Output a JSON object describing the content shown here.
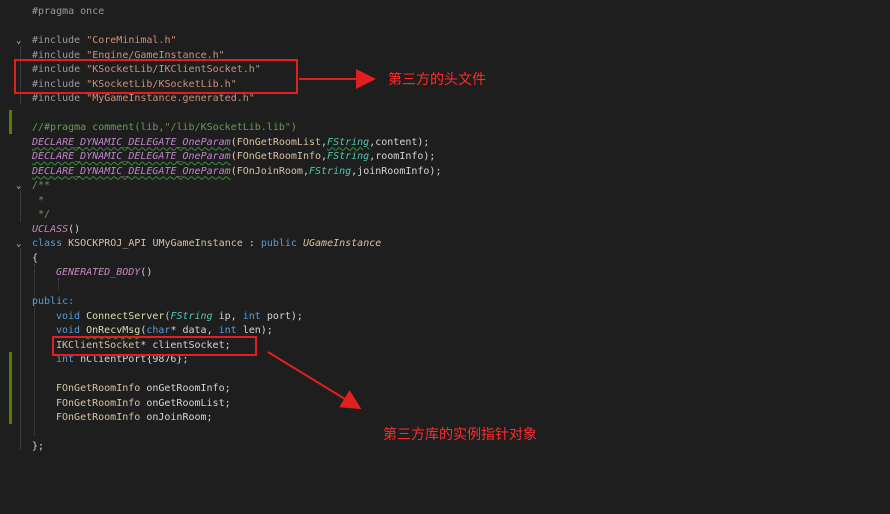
{
  "code": {
    "pragma": "#pragma once",
    "include_kw": "#include",
    "includes": [
      "\"CoreMinimal.h\"",
      "\"Engine/GameInstance.h\"",
      "\"KSocketLib/IKClientSocket.h\"",
      "\"KSocketLib/KSocketLib.h\"",
      "\"MyGameInstance.generated.h\""
    ],
    "comment_pragma": "//#pragma comment(lib,\"/lib/KSocketLib.lib\")",
    "delegate_macro": "DECLARE_DYNAMIC_DELEGATE_OneParam",
    "delegates": [
      {
        "name": "FOnGetRoomList",
        "type": "FString",
        "param": "content"
      },
      {
        "name": "FOnGetRoomInfo",
        "type": "FString",
        "param": "roomInfo"
      },
      {
        "name": "FOnJoinRoom",
        "type": "FString",
        "param": "joinRoomInfo"
      }
    ],
    "doc_open": "/**",
    "doc_mid": " *",
    "doc_close": " */",
    "uclass": "UCLASS",
    "class_kw": "class",
    "api": "KSOCKPROJ_API",
    "class_name": "UMyGameInstance",
    "public_kw": "public",
    "base_class": "UGameInstance",
    "open_brace": "{",
    "generated_body": "GENERATED_BODY",
    "public_label": "public:",
    "void_kw": "void",
    "int_kw": "int",
    "char_kw": "char",
    "connect_fn": "ConnectServer",
    "fstring": "FString",
    "ip": "ip",
    "port": "port",
    "recv_fn": "OnRecvMsg",
    "data": "data",
    "len": "len",
    "socket_type": "IKClientSocket",
    "socket_var": "clientSocket",
    "port_decl": "nClientPort{9876}",
    "members": [
      {
        "type": "FOnGetRoomInfo",
        "name": "onGetRoomInfo"
      },
      {
        "type": "FOnGetRoomInfo",
        "name": "onGetRoomList"
      },
      {
        "type": "FOnGetRoomInfo",
        "name": "onJoinRoom"
      }
    ],
    "close_brace": "};"
  },
  "annotations": {
    "headers": "第三方的头文件",
    "instance_pointer": "第三方库的实例指针对象"
  },
  "colors": {
    "annotation": "#e02020",
    "background": "#1e1e1e",
    "keyword": "#569cd6",
    "string": "#ce9178",
    "comment": "#6a9955",
    "macro": "#be86c9",
    "function": "#dcdcaa",
    "gutter_added": "#587c0c"
  },
  "icons": {
    "fold": "chevron-down-icon"
  }
}
